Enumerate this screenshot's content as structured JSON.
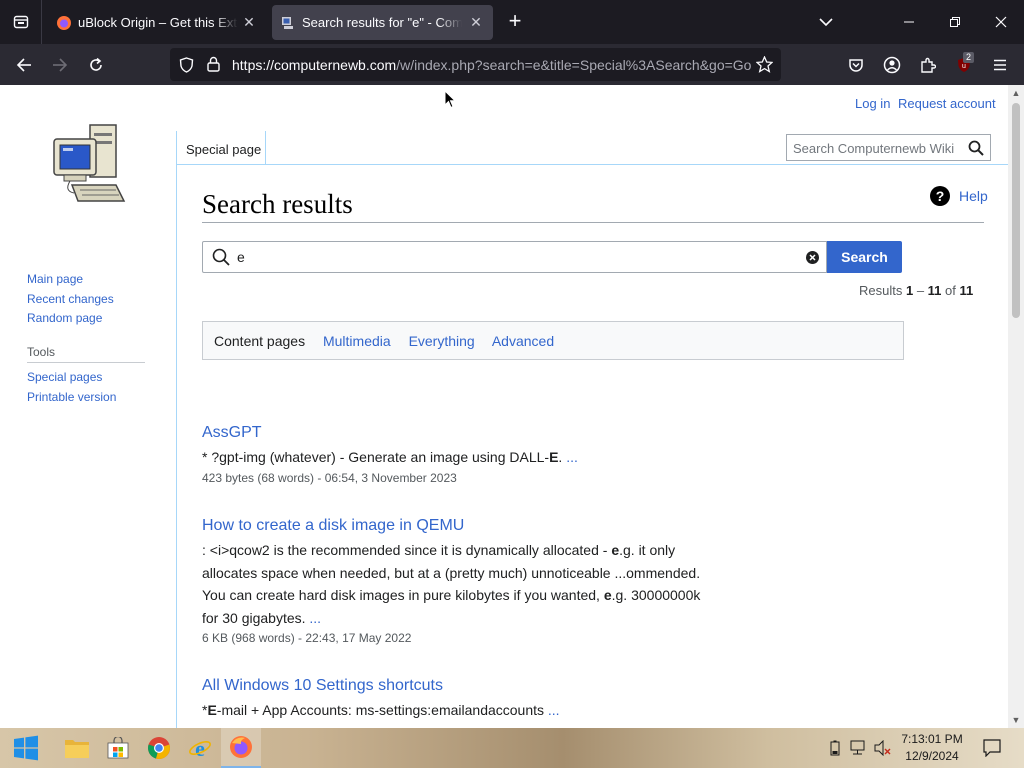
{
  "browser": {
    "tabs": [
      {
        "title": "uBlock Origin – Get this Extensi",
        "active": false
      },
      {
        "title": "Search results for \"e\" - Comput",
        "active": true
      }
    ],
    "url_host": "https://computernewb.com",
    "url_path": "/w/index.php?search=e&title=Special%3ASearch&go=Go",
    "extension_badge": "2"
  },
  "wiki": {
    "personal": {
      "login": "Log in",
      "request_account": "Request account"
    },
    "nav": [
      "Main page",
      "Recent changes",
      "Random page"
    ],
    "tools_heading": "Tools",
    "tools": [
      "Special pages",
      "Printable version"
    ],
    "namespace_tab": "Special page",
    "search_placeholder": "Search Computernewb Wiki",
    "heading": "Search results",
    "help": "Help",
    "query": "e",
    "search_button": "Search",
    "results_info": {
      "prefix": "Results ",
      "from": "1",
      "dash": " – ",
      "to": "11",
      "of": " of ",
      "total": "11"
    },
    "profiles": [
      {
        "label": "Content pages",
        "active": true
      },
      {
        "label": "Multimedia",
        "active": false
      },
      {
        "label": "Everything",
        "active": false
      },
      {
        "label": "Advanced",
        "active": false
      }
    ],
    "results": [
      {
        "title": "AssGPT",
        "snippet_lines": [
          "* ?gpt-img (whatever) - Generate an image using DALL-E. ..."
        ],
        "meta": "423 bytes (68 words) - 06:54, 3 November 2023"
      },
      {
        "title": "How to create a disk image in QEMU",
        "snippet_lines": [
          ": <i>qcow2 is the recommended since it is dynamically allocated - e.g. it only",
          "allocates space when needed, but at a (pretty much) unnoticeable ...ommended.",
          "You can create hard disk images in pure kilobytes if you wanted, e.g. 30000000k",
          "for 30 gigabytes. ..."
        ],
        "meta": "6 KB (968 words) - 22:43, 17 May 2022"
      },
      {
        "title": "All Windows 10 Settings shortcuts",
        "snippet_lines": [
          "*E-mail + App Accounts: ms-settings:emailandaccounts ..."
        ],
        "meta": ""
      }
    ]
  },
  "taskbar": {
    "time": "7:13:01 PM",
    "date": "12/9/2024"
  },
  "colors": {
    "link": "#3366cc",
    "tab_active": "#42414d",
    "accent": "#3366cc"
  }
}
